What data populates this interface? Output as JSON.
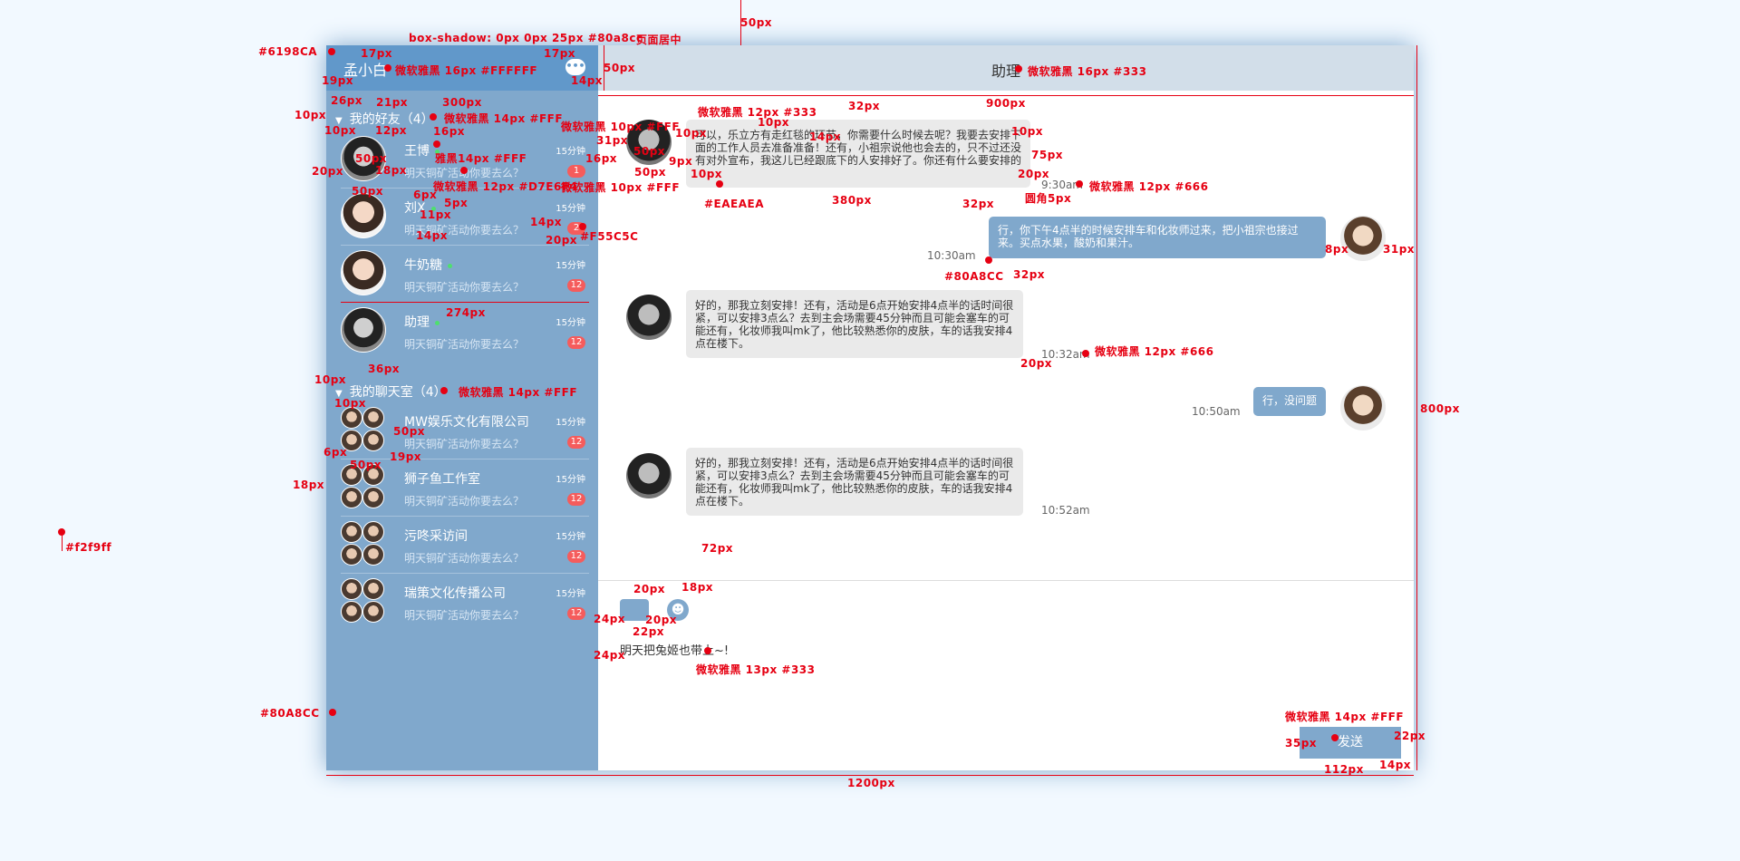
{
  "app": {
    "user_name": "孟小白",
    "chat_icon": "chat-bubble-icon",
    "groups": [
      {
        "title": "我的好友（4）",
        "items": [
          {
            "name": "王博",
            "online": true,
            "time": "15分钟",
            "msg": "明天铜矿活动你要去么？",
            "badge": "1"
          },
          {
            "name": "刘X",
            "online": true,
            "time": "15分钟",
            "msg": "明天铜矿活动你要去么？",
            "badge": "2"
          },
          {
            "name": "牛奶糖",
            "online": true,
            "time": "15分钟",
            "msg": "明天铜矿活动你要去么？",
            "badge": "12"
          },
          {
            "name": "助理",
            "online": true,
            "time": "15分钟",
            "msg": "明天铜矿活动你要去么？",
            "badge": "12"
          }
        ]
      },
      {
        "title": "我的聊天室（4）",
        "items": [
          {
            "name": "MW娱乐文化有限公司",
            "time": "15分钟",
            "msg": "明天铜矿活动你要去么？",
            "badge": "12"
          },
          {
            "name": "狮子鱼工作室",
            "time": "15分钟",
            "msg": "明天铜矿活动你要去么？",
            "badge": "12"
          },
          {
            "name": "污咚采访间",
            "time": "15分钟",
            "msg": "明天铜矿活动你要去么？",
            "badge": "12"
          },
          {
            "name": "瑞策文化传播公司",
            "time": "15分钟",
            "msg": "明天铜矿活动你要去么？",
            "badge": "12"
          }
        ]
      }
    ],
    "chat_title": "助理",
    "messages": [
      {
        "side": "left",
        "text": "可以，乐立方有走红毯的环节，你需要什么时候去呢？我要去安排下面的工作人员去准备准备！还有，小祖宗说他也会去的，只不过还没有对外宣布，我这儿已经跟底下的人安排好了。你还有什么要安排的",
        "time": "9:30am"
      },
      {
        "side": "right",
        "text": "行，你下午4点半的时候安排车和化妆师过来，把小祖宗也接过来。买点水果，酸奶和果汁。",
        "time": "10:30am"
      },
      {
        "side": "left",
        "text": "好的，那我立刻安排！还有，活动是6点开始安排4点半的话时间很紧，可以安排3点么？去到主会场需要45分钟而且可能会塞车的可能还有，化妆师我叫mk了，他比较熟悉你的皮肤，车的话我安排4点在楼下。",
        "time": "10:32am"
      },
      {
        "side": "right",
        "text": "行，没问题",
        "time": "10:50am"
      },
      {
        "side": "left",
        "text": "好的，那我立刻安排！还有，活动是6点开始安排4点半的话时间很紧，可以安排3点么？去到主会场需要45分钟而且可能会塞车的可能还有，化妆师我叫mk了，他比较熟悉你的皮肤，车的话我安排4点在楼下。",
        "time": "10:52am"
      }
    ],
    "input_text": "明天把兔姬也带上~!",
    "image_icon": "image-icon",
    "emoji_icon": "emoji-icon",
    "send_label": "发送",
    "colors": {
      "page_bg": "#f2f9ff",
      "sidebar": "#80a8cc",
      "sidebar_head": "#6198ca",
      "badge": "#f55c5c",
      "bubble": "#eaeaea",
      "chat_head": "#d2dee9"
    }
  },
  "annotations": {
    "shadow": "box-shadow: 0px 0px 25px #80a8cc",
    "center": "页面居中",
    "top_gap": "50px",
    "c_head": "#6198CA",
    "head_font": "微软雅黑 16px #FFFFFF",
    "chat_font": "微软雅黑 16px #333",
    "group_font": "微软雅黑 14px #FFF",
    "name_font": "雅黑14px #FFF",
    "msg_font": "微软雅黑 12px #D7E6F4",
    "time_font": "微软雅黑 10px #FFF",
    "bubble_font": "微软雅黑 12px #333",
    "ctime_font": "微软雅黑 12px #666",
    "input_font": "微软雅黑 13px #333",
    "send_font": "微软雅黑 14px #FFF",
    "bubble_color": "#EAEAEA",
    "badge_color": "#F55C5C",
    "right_color": "#80A8CC",
    "sidebar_color": "#80A8CC",
    "page_color": "#f2f9ff",
    "w1200": "1200px",
    "w900": "900px",
    "h800": "800px",
    "w300": "300px",
    "w274": "274px",
    "w380": "380px",
    "w112": "112px",
    "h50a": "50px",
    "h50b": "50px",
    "p17a": "17px",
    "p17b": "17px",
    "p19": "19px",
    "p14": "14px",
    "p26": "26px",
    "p21": "21px",
    "p10a": "10px",
    "p10b": "10px",
    "p12": "12px",
    "p16": "16px",
    "p50a": "50px",
    "p18": "18px",
    "p20a": "20px",
    "p6": "6px",
    "p5": "5px",
    "p11": "11px",
    "p14b": "14px",
    "p14c": "14px",
    "p20b": "20px",
    "p36": "36px",
    "p10c": "10px",
    "p10d": "10px",
    "p50c": "50px",
    "p19b": "19px",
    "p6b": "6px",
    "p50d": "50px",
    "p18b": "18px",
    "p32a": "32px",
    "p10e": "10px",
    "p31": "31px",
    "p50e": "50px",
    "p9": "9px",
    "p16b": "16px",
    "p50f": "50px",
    "p10f": "10px",
    "p14d": "14px",
    "p10g": "10px",
    "p75": "75px",
    "p20c": "20px",
    "p5b": "圆角5px",
    "p32b": "32px",
    "p8": "8px",
    "p31b": "31px",
    "p32c": "32px",
    "p20d": "20px",
    "p72": "72px",
    "p20e": "20px",
    "p18c": "18px",
    "p24a": "24px",
    "p20f": "20px",
    "p22": "22px",
    "p24b": "24px",
    "p35": "35px",
    "p22b": "22px",
    "p14e": "14px"
  }
}
